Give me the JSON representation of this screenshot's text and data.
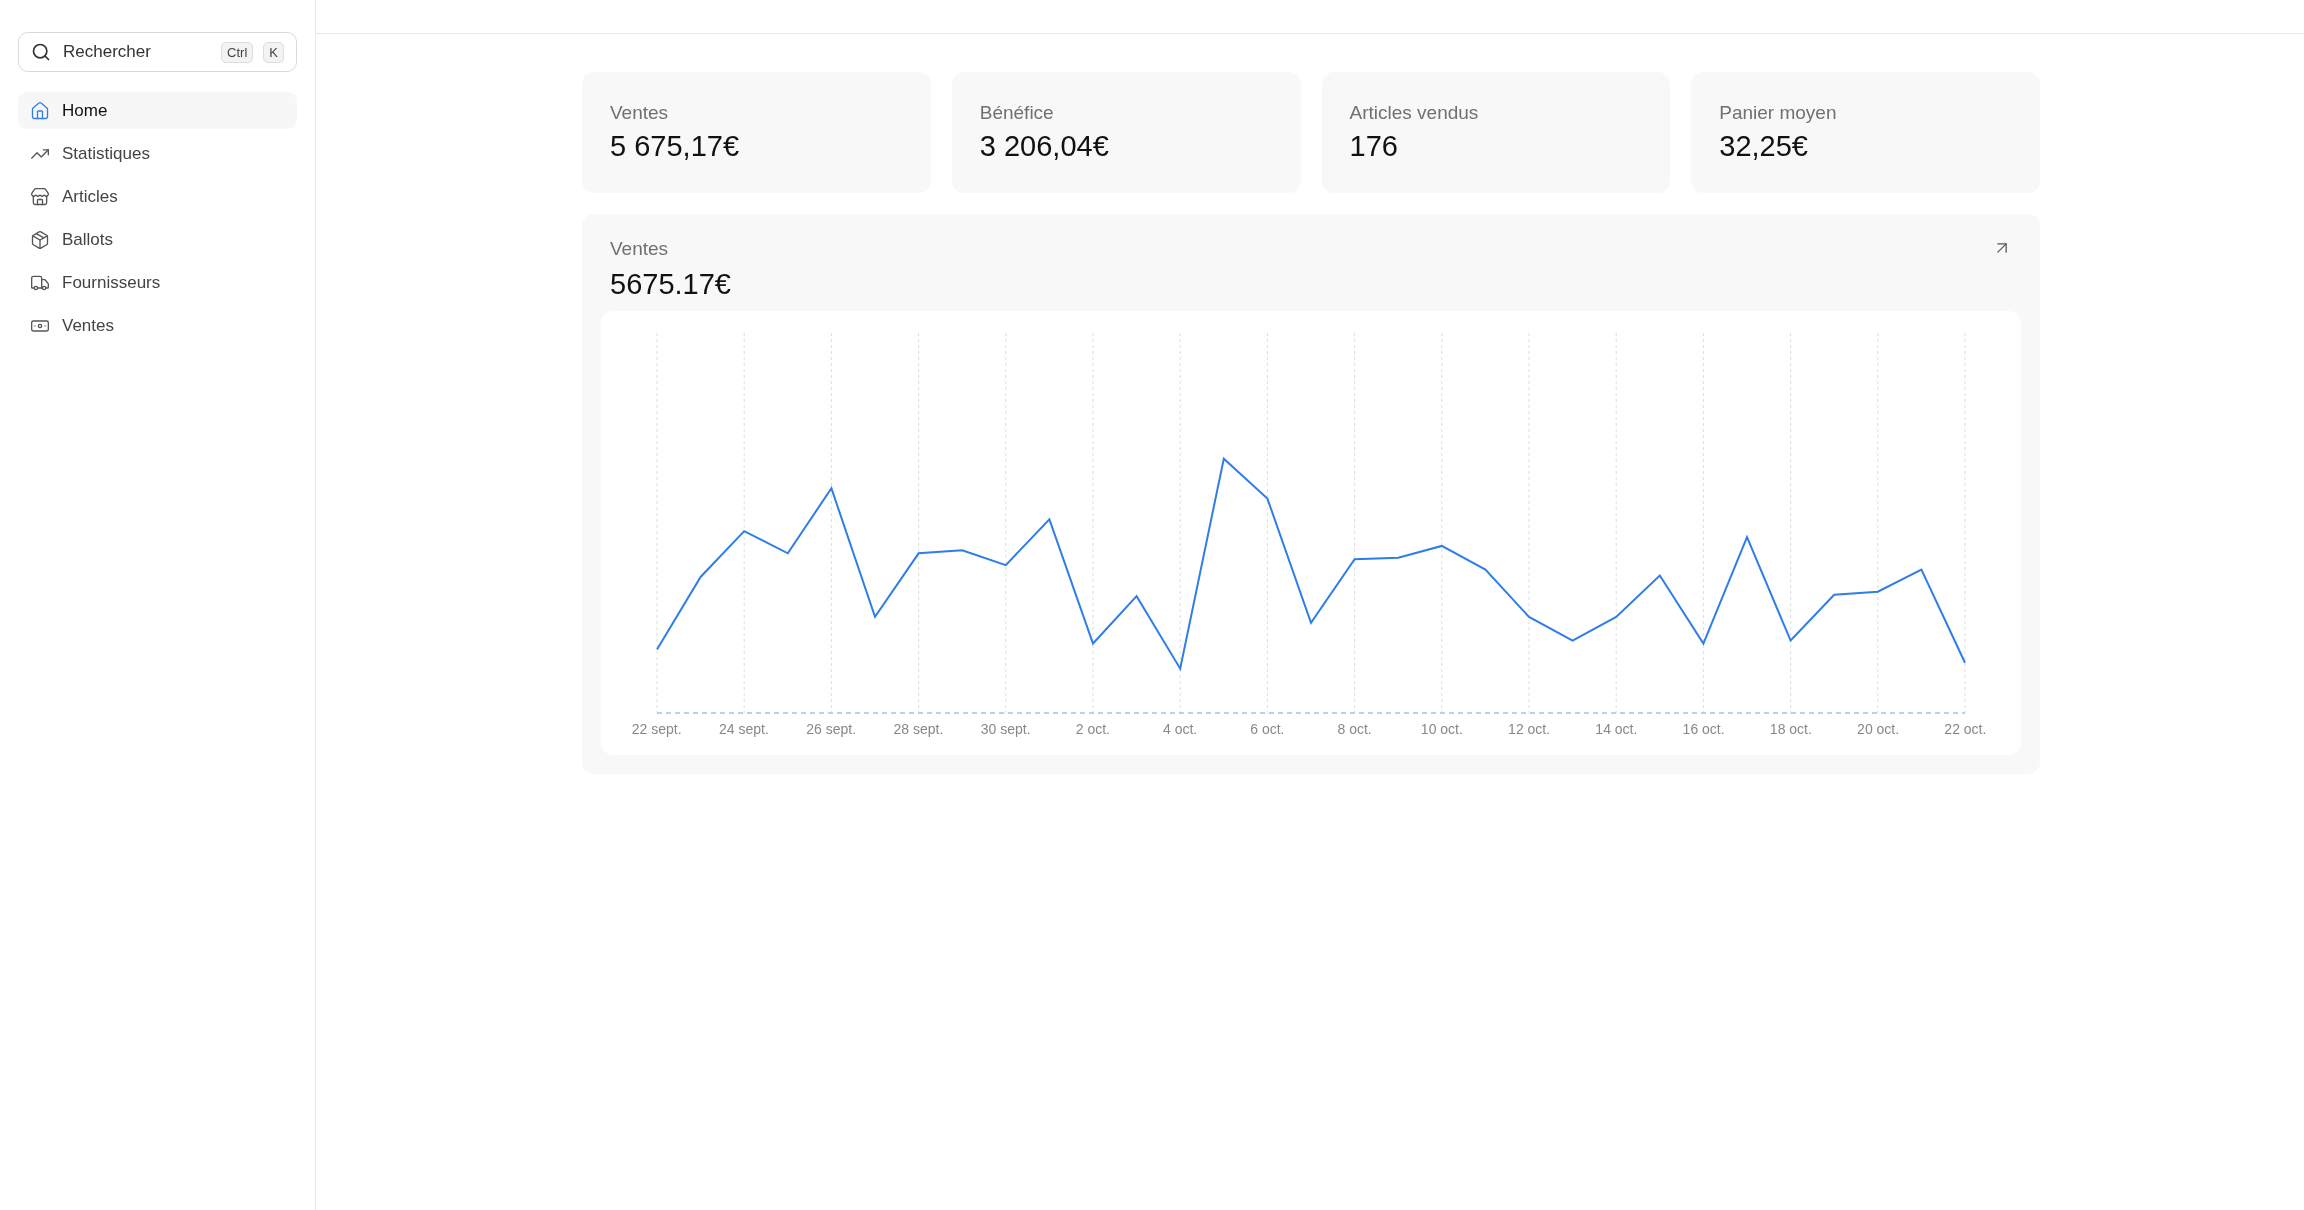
{
  "search": {
    "placeholder": "Rechercher",
    "keys": [
      "Ctrl",
      "K"
    ]
  },
  "nav": [
    {
      "kind": "home",
      "label": "Home",
      "selected": true
    },
    {
      "kind": "trend",
      "label": "Statistiques",
      "selected": false
    },
    {
      "kind": "store",
      "label": "Articles",
      "selected": false
    },
    {
      "kind": "box",
      "label": "Ballots",
      "selected": false
    },
    {
      "kind": "truck",
      "label": "Fournisseurs",
      "selected": false
    },
    {
      "kind": "cash",
      "label": "Ventes",
      "selected": false
    }
  ],
  "stats": [
    {
      "label": "Ventes",
      "value": "5 675,17€"
    },
    {
      "label": "Bénéfice",
      "value": "3 206,04€"
    },
    {
      "label": "Articles vendus",
      "value": "176"
    },
    {
      "label": "Panier moyen",
      "value": "32,25€"
    }
  ],
  "sales_chart": {
    "title": "Ventes",
    "total": "5675.17€",
    "x_labels": [
      "22 sept.",
      "24 sept.",
      "26 sept.",
      "28 sept.",
      "30 sept.",
      "2 oct.",
      "4 oct.",
      "6 oct.",
      "8 oct.",
      "10 oct.",
      "12 oct.",
      "14 oct.",
      "16 oct.",
      "18 oct.",
      "20 oct.",
      "22 oct."
    ]
  }
}
